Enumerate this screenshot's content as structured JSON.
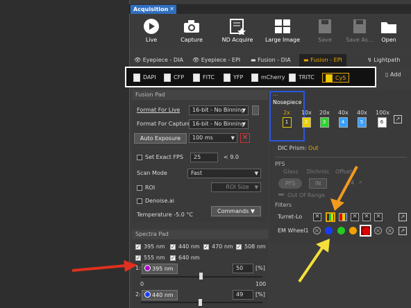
{
  "window": {
    "tab_title": "Acquisition",
    "tab_close": "×"
  },
  "toolbar": {
    "live": "Live",
    "capture": "Capture",
    "nd_acquire": "ND Acquire",
    "large_image": "Large Image",
    "save": "Save",
    "save_as": "Save As...",
    "open": "Open"
  },
  "modes": {
    "items": [
      "Eyepiece - DIA",
      "Eyepiece - EPI",
      "Fusion - DIA",
      "Fusion - EPI"
    ],
    "selected": "Fusion - EPI",
    "lightpath": "Lightpath",
    "add": "Add"
  },
  "filters": {
    "items": [
      "DAPI",
      "CFP",
      "FITC",
      "YFP",
      "mCherry",
      "TRITC",
      "Cy5"
    ],
    "selected": "Cy5"
  },
  "fusion_pad": {
    "title": "Fusion Pad",
    "format_live_label": "Format For Live",
    "format_live_value": "16-bit - No Binning",
    "format_capture_label": "Format For Capture",
    "format_capture_value": "16-bit - No Binning",
    "auto_exposure": "Auto Exposure",
    "exposure_value": "100 ms",
    "set_exact_fps": "Set Exact FPS",
    "fps_value": "25",
    "fps_max": "< 9.0",
    "scan_mode_label": "Scan Mode",
    "scan_mode_value": "Fast",
    "roi": "ROI",
    "roi_size": "ROI Size",
    "denoise": "Denoise.ai",
    "temperature": "Temperature -5.0 °C",
    "commands": "Commands"
  },
  "spectra_pad": {
    "title": "Spectra Pad",
    "wavelengths": [
      {
        "label": "395 nm",
        "checked": true
      },
      {
        "label": "440 nm",
        "checked": true
      },
      {
        "label": "470 nm",
        "checked": true
      },
      {
        "label": "508 nm",
        "checked": true
      },
      {
        "label": "555 nm",
        "checked": true
      },
      {
        "label": "640 nm",
        "checked": true
      }
    ],
    "channels": [
      {
        "index": "1:",
        "name": "395 nm",
        "value": "50",
        "unit": "[%]",
        "min": "0",
        "max": "100",
        "dot": "#b000d0"
      },
      {
        "index": "2:",
        "name": "440 nm",
        "value": "49",
        "unit": "[%]",
        "min": "0",
        "max": "100",
        "dot": "#1a3cff"
      }
    ]
  },
  "right_panel": {
    "header": "...",
    "nosepiece_title": "Nosepiece",
    "objectives": [
      {
        "mag": "2x",
        "slot": "1",
        "color": "#e8d000"
      },
      {
        "mag": "10x",
        "slot": "2",
        "color": "#e8d000"
      },
      {
        "mag": "20x",
        "slot": "3",
        "color": "#2bd62b"
      },
      {
        "mag": "40x",
        "slot": "4",
        "color": "#3aa0ff"
      },
      {
        "mag": "40x",
        "slot": "5",
        "color": "#3aa0ff"
      },
      {
        "mag": "100x",
        "slot": "6",
        "color": "#ffffff"
      }
    ],
    "dic_prism_label": "DIC Prism:",
    "dic_prism_value": "Out",
    "pfs_title": "PFS",
    "pfs_glass": "Glass",
    "pfs_dichroic": "Dichroic",
    "pfs_offset": "Offset",
    "pfs_btn": "PFS",
    "in_btn": "IN",
    "offset_value": "24",
    "out_of_range": "Out Of Range",
    "filters_title": "Filters",
    "turret_label": "Turret-Lo",
    "emwheel_label": "EM Wheel1",
    "emwheel_colors": [
      "#1a3cff",
      "#22cc22",
      "#f0a000",
      "#dd0000"
    ]
  }
}
